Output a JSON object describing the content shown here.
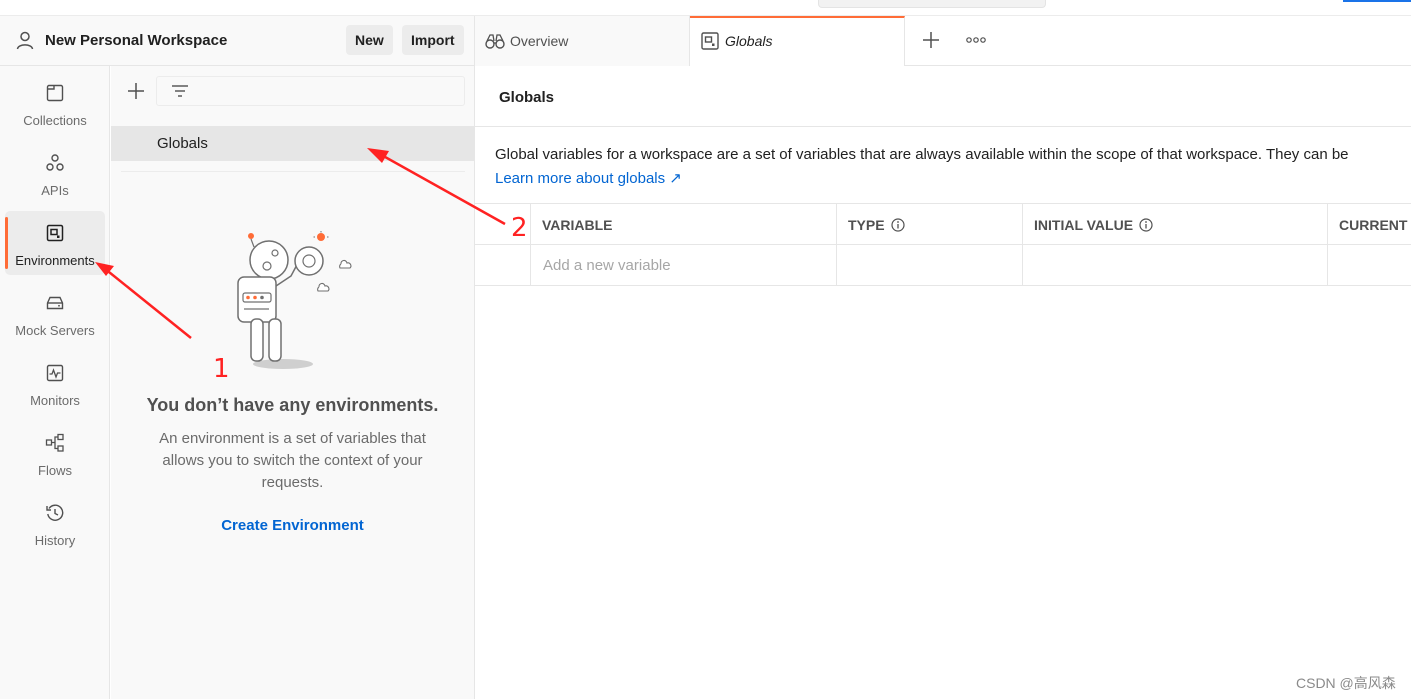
{
  "workspace": {
    "title": "New Personal Workspace",
    "new_label": "New",
    "import_label": "Import"
  },
  "rail": {
    "items": [
      {
        "label": "Collections",
        "icon": "collections-icon"
      },
      {
        "label": "APIs",
        "icon": "apis-icon"
      },
      {
        "label": "Environments",
        "icon": "environments-icon",
        "active": true
      },
      {
        "label": "Mock Servers",
        "icon": "mock-servers-icon"
      },
      {
        "label": "Monitors",
        "icon": "monitors-icon"
      },
      {
        "label": "Flows",
        "icon": "flows-icon"
      },
      {
        "label": "History",
        "icon": "history-icon"
      }
    ]
  },
  "env_panel": {
    "globals_label": "Globals",
    "empty_title": "You don’t have any environments.",
    "empty_desc": "An environment is a set of variables that allows you to switch the context of your requests.",
    "create_label": "Create Environment"
  },
  "tabs": [
    {
      "label": "Overview",
      "icon": "overview-icon"
    },
    {
      "label": "Globals",
      "icon": "globals-icon",
      "active": true
    }
  ],
  "main": {
    "title": "Globals",
    "description": "Global variables for a workspace are a set of variables that are always available within the scope of that workspace. They can be",
    "learn_link": "Learn more about globals ↗",
    "columns": {
      "variable": "VARIABLE",
      "type": "TYPE",
      "initial": "INITIAL VALUE",
      "current": "CURRENT"
    },
    "new_variable_placeholder": "Add a new variable"
  },
  "annotations": {
    "num1": "1",
    "num2": "2"
  },
  "watermark": "CSDN @高风森",
  "colors": {
    "accent": "#ff6c37",
    "link": "#0265d2",
    "annotation": "#ff2222"
  }
}
